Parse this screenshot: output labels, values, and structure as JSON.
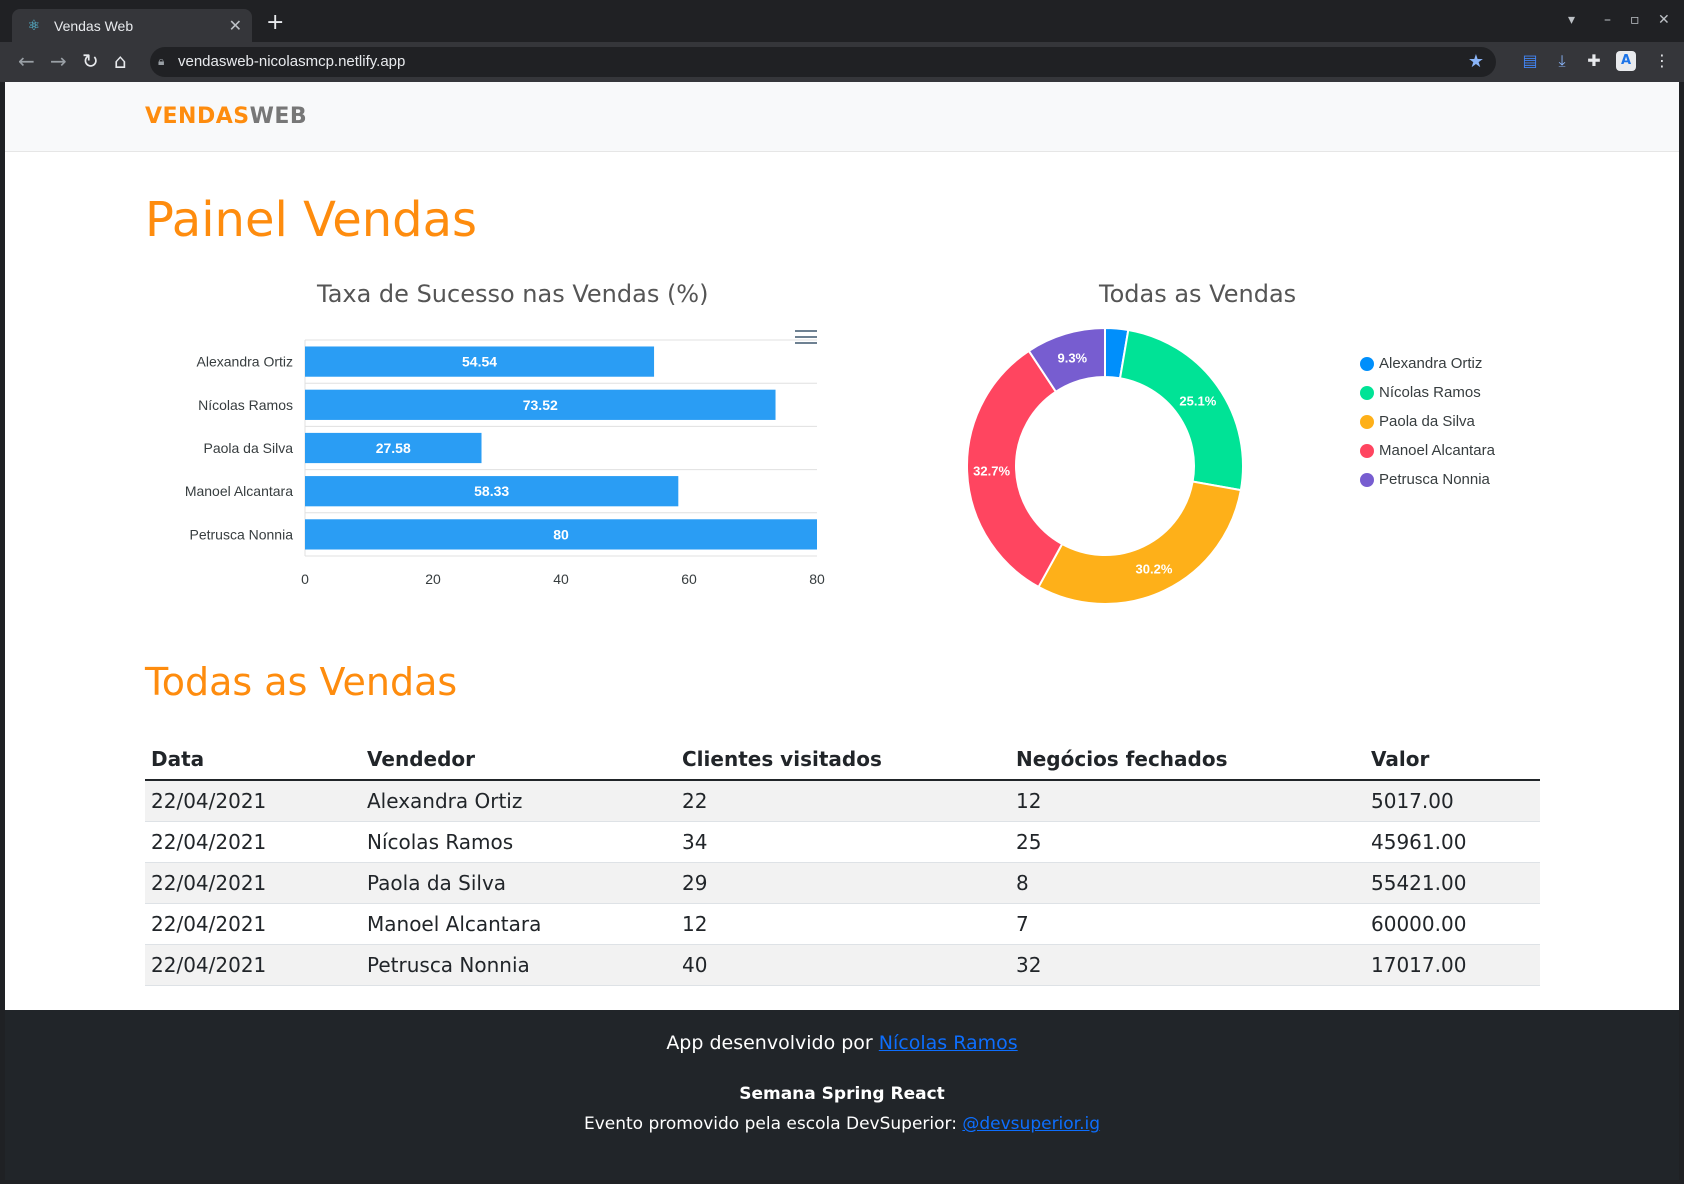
{
  "browser": {
    "tab_title": "Vendas Web",
    "url": "vendasweb-nicolasmcp.netlify.app"
  },
  "navbar": {
    "logo_part1": "VENDAS",
    "logo_part2": "WEB"
  },
  "page_title": "Painel Vendas",
  "charts_section": {
    "bar_title": "Taxa de Sucesso nas Vendas (%)",
    "donut_title": "Todas as Vendas"
  },
  "chart_data": [
    {
      "type": "bar",
      "orientation": "horizontal",
      "title": "Taxa de Sucesso nas Vendas (%)",
      "categories": [
        "Alexandra Ortiz",
        "Nícolas Ramos",
        "Paola da Silva",
        "Manoel Alcantara",
        "Petrusca Nonnia"
      ],
      "values": [
        54.54,
        73.52,
        27.58,
        58.33,
        80
      ],
      "xlim": [
        0,
        80
      ],
      "xticks": [
        0,
        20,
        40,
        60,
        80
      ],
      "color": "#2a9df4",
      "grid": true
    },
    {
      "type": "pie",
      "variant": "donut",
      "title": "Todas as Vendas",
      "labels": [
        "Alexandra Ortiz",
        "Nícolas Ramos",
        "Paola da Silva",
        "Manoel Alcantara",
        "Petrusca Nonnia"
      ],
      "values": [
        2.7,
        25.1,
        30.2,
        32.7,
        9.3
      ],
      "value_labels": [
        "",
        "25.1%",
        "30.2%",
        "32.7%",
        "9.3%"
      ],
      "colors": [
        "#008ffb",
        "#00e396",
        "#feb019",
        "#ff4560",
        "#775dd0"
      ],
      "legend_position": "right"
    }
  ],
  "sales_section": {
    "title": "Todas as Vendas"
  },
  "table": {
    "headers": [
      "Data",
      "Vendedor",
      "Clientes visitados",
      "Negócios fechados",
      "Valor"
    ],
    "rows": [
      [
        "22/04/2021",
        "Alexandra Ortiz",
        "22",
        "12",
        "5017.00"
      ],
      [
        "22/04/2021",
        "Nícolas Ramos",
        "34",
        "25",
        "45961.00"
      ],
      [
        "22/04/2021",
        "Paola da Silva",
        "29",
        "8",
        "55421.00"
      ],
      [
        "22/04/2021",
        "Manoel Alcantara",
        "12",
        "7",
        "60000.00"
      ],
      [
        "22/04/2021",
        "Petrusca Nonnia",
        "40",
        "32",
        "17017.00"
      ]
    ]
  },
  "footer": {
    "line1_prefix": "App desenvolvido por ",
    "line1_link": "Nícolas Ramos",
    "line2": "Semana Spring React",
    "line3_prefix": "Evento promovido pela escola DevSuperior: ",
    "line3_link": "@devsuperior.ig"
  }
}
